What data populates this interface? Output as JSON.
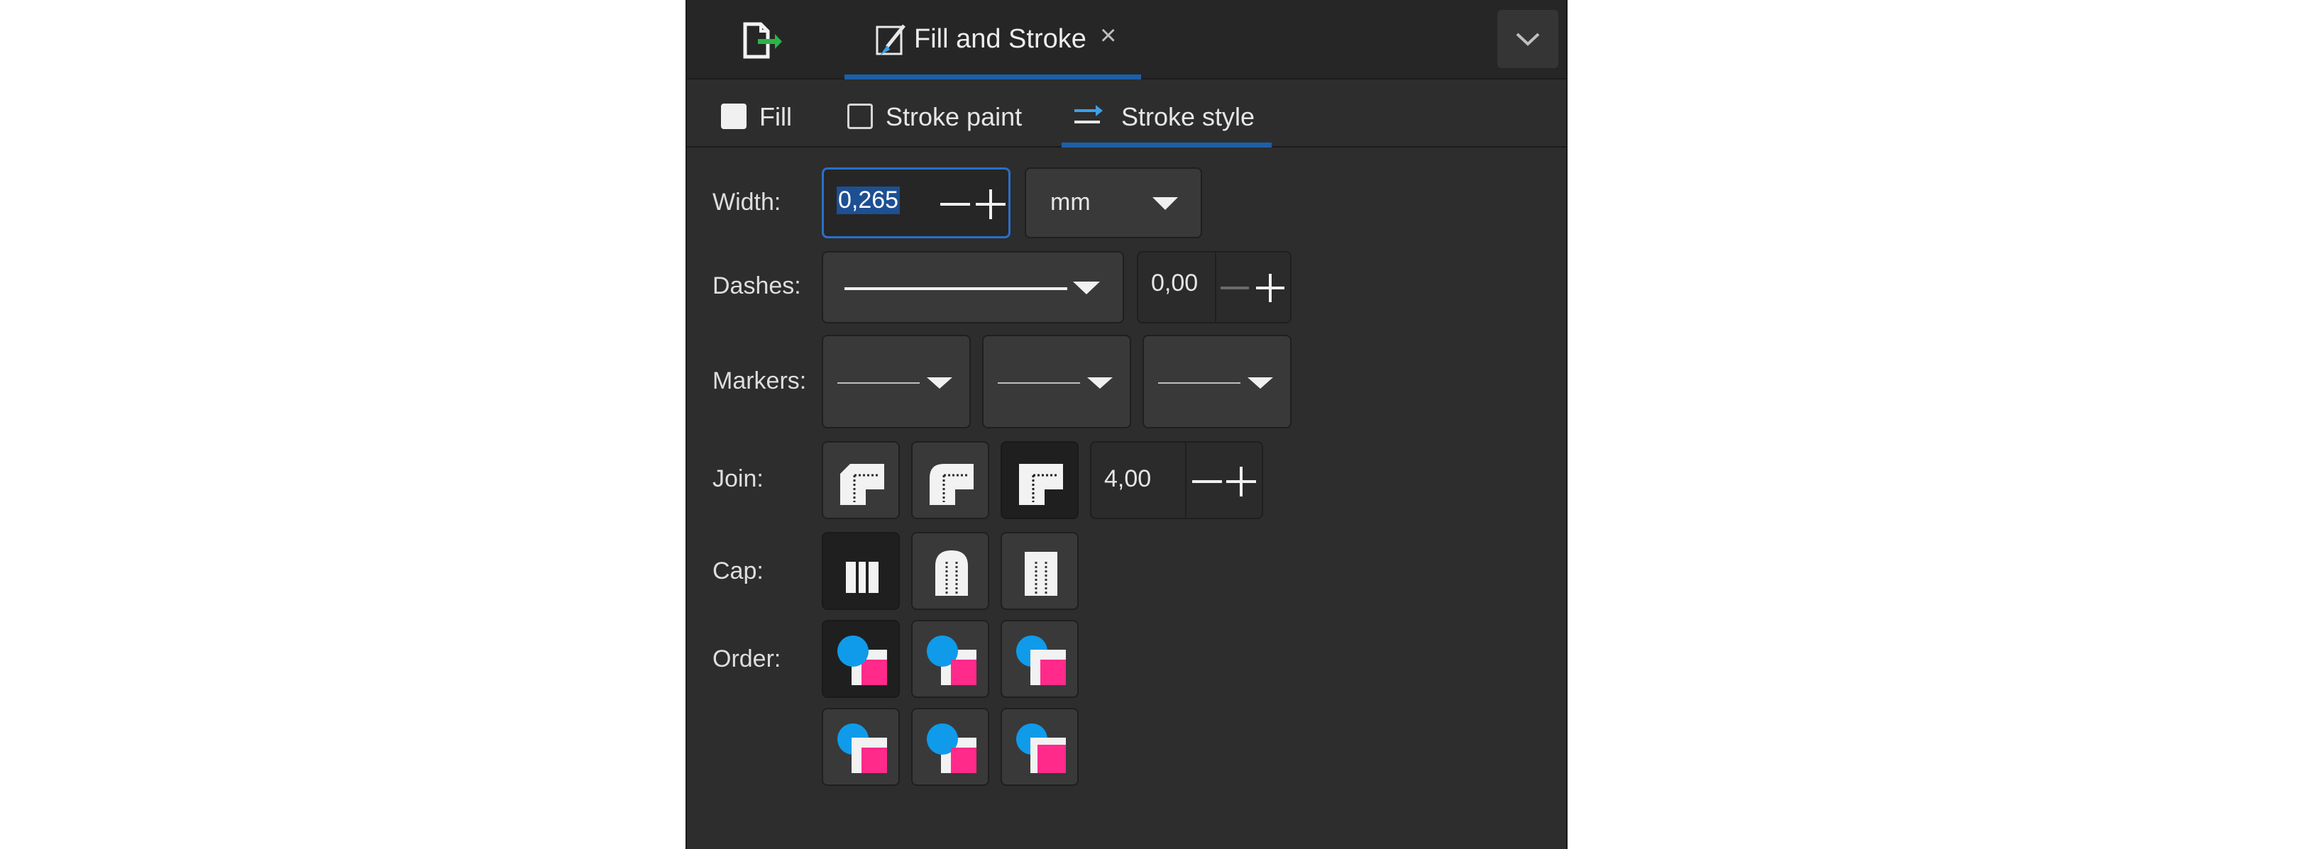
{
  "header": {
    "tab_title": "Fill and Stroke",
    "close_glyph": "×",
    "icons": [
      "document-export-icon",
      "paintbrush-icon",
      "chevron-down-icon"
    ]
  },
  "subtabs": {
    "fill_label": "Fill",
    "stroke_paint_label": "Stroke paint",
    "stroke_style_label": "Stroke style"
  },
  "stroke_style": {
    "width_label": "Width:",
    "width_value": "0,265",
    "unit_value": "mm",
    "dashes_label": "Dashes:",
    "dash_offset": "0,00",
    "markers_label": "Markers:",
    "join_label": "Join:",
    "miter_limit": "4,00",
    "cap_label": "Cap:",
    "order_label": "Order:"
  },
  "colors": {
    "accent": "#1d5fa8",
    "order_circle": "#0f9bea",
    "order_square": "#ff2a8a",
    "panel_bg": "#2d2d2d"
  }
}
